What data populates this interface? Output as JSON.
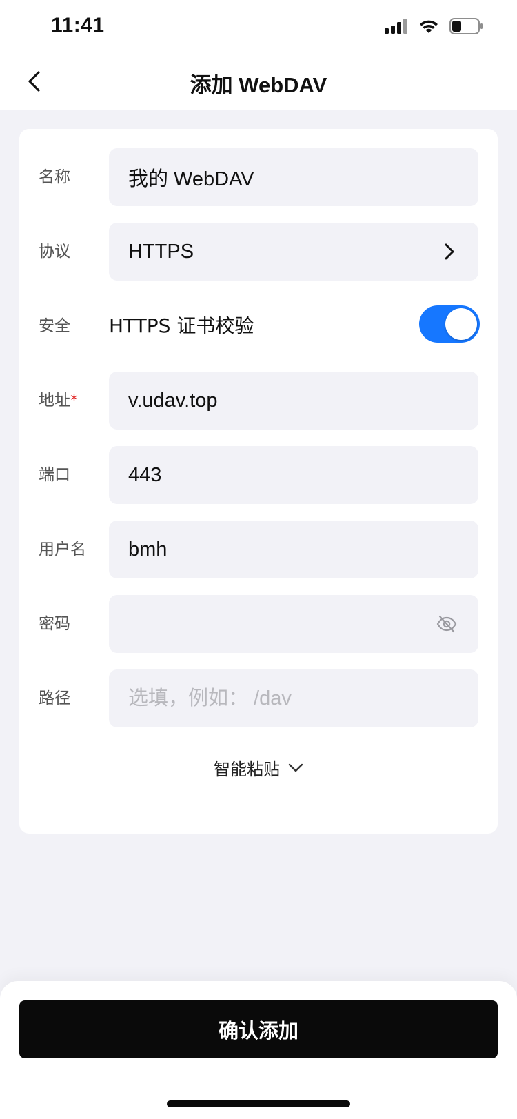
{
  "status_bar": {
    "time": "11:41"
  },
  "nav": {
    "title": "添加 WebDAV"
  },
  "form": {
    "name": {
      "label": "名称",
      "value": "我的 WebDAV"
    },
    "protocol": {
      "label": "协议",
      "value": "HTTPS"
    },
    "security": {
      "label": "安全",
      "toggle_label": "HTTPS 证书校验",
      "enabled": true
    },
    "address": {
      "label": "地址",
      "required_mark": "*",
      "value": "v.udav.top"
    },
    "port": {
      "label": "端口",
      "value": "443"
    },
    "username": {
      "label": "用户名",
      "value": "bmh"
    },
    "password": {
      "label": "密码",
      "value": ""
    },
    "path": {
      "label": "路径",
      "value": "",
      "placeholder": "选填，例如： /dav"
    },
    "smart_paste_label": "智能粘贴"
  },
  "footer": {
    "confirm_label": "确认添加"
  },
  "colors": {
    "accent": "#1677ff",
    "primary_button": "#0a0a0a",
    "required": "#e02424",
    "background": "#f2f2f7"
  },
  "icons": {
    "back": "chevron-left-icon",
    "protocol_arrow": "chevron-right-icon",
    "password_visibility": "eye-off-icon",
    "smart_paste": "chevron-down-icon",
    "signal": "cellular-signal-icon",
    "wifi": "wifi-icon",
    "battery": "battery-icon"
  }
}
